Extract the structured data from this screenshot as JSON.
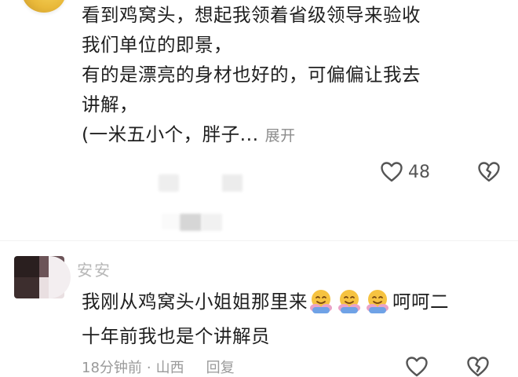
{
  "comment1": {
    "lines": [
      "看到鸡窝头，想起我领着省级领导来验收",
      "我们单位的即景，",
      "有的是漂亮的身材也好的，可偏偏让我去",
      "讲解，",
      "(一米五小个，胖子..."
    ],
    "expand_label": "展开",
    "like_count": "48"
  },
  "comment2": {
    "username": "安安",
    "line1_before_emoji": "我刚从鸡窝头小姐姐那里来",
    "line1_after_emoji": "呵呵二",
    "line2": "十年前我也是个讲解员",
    "emojis": [
      "hugging-face-emoji",
      "hugging-face-emoji",
      "hugging-face-emoji"
    ],
    "time": "18分钟前",
    "separator": "·",
    "location": "山西",
    "reply_label": "回复"
  },
  "icons": {
    "like": "heart-outline-icon",
    "dislike": "broken-heart-icon"
  },
  "colors": {
    "text": "#1f1f1f",
    "meta": "#9a9a9a",
    "username": "#b7b7b7",
    "emoji": "#f6c341"
  }
}
